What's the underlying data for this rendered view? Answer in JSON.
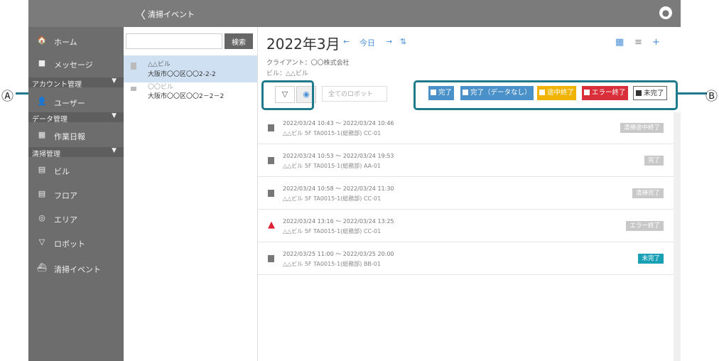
{
  "topbar": {
    "back": "〈",
    "title": "清掃イベント"
  },
  "sidebar": {
    "items": [
      {
        "icon": "🏠",
        "label": "ホーム"
      },
      {
        "icon": "■",
        "label": "メッセージ"
      }
    ],
    "sec1": "アカウント管理",
    "user": {
      "icon": "👤",
      "label": "ユーザー"
    },
    "sec2": "データ管理",
    "work": {
      "icon": "▦",
      "label": "作業日報"
    },
    "sec3": "清掃管理",
    "items2": [
      {
        "icon": "▤",
        "label": "ビル"
      },
      {
        "icon": "▤",
        "label": "フロア"
      },
      {
        "icon": "◎",
        "label": "エリア"
      },
      {
        "icon": "▽",
        "label": "ロボット"
      },
      {
        "icon": "⛴",
        "label": "清掃イベント"
      }
    ]
  },
  "list": {
    "search_btn": "検索",
    "buildings": [
      {
        "name": "△△ビル",
        "addr": "大阪市〇〇区〇〇2-2-2"
      },
      {
        "name": "〇〇ビル",
        "addr": "大阪市〇〇区〇〇2－2－2"
      }
    ]
  },
  "main": {
    "month": "2022年3月",
    "prev": "←",
    "today": "今日",
    "next": "→",
    "sort": "⇅",
    "client": "クライアント：〇〇株式会社",
    "building": "ビル：△△ビル",
    "robot_select": "全てのロボット",
    "chips": [
      {
        "label": "完了",
        "color": "#4a90c9"
      },
      {
        "label": "完了（データなし）",
        "color": "#4a90c9"
      },
      {
        "label": "途中終了",
        "color": "#f0b400"
      },
      {
        "label": "エラー終了",
        "color": "#d92f3a"
      },
      {
        "label": "未完了",
        "color": "#ffffff"
      }
    ],
    "events": [
      {
        "time": "2022/03/24 10:43 ～ 2022/03/24 10:46",
        "loc": "△△ビル 5F TA0015-1(総務部) CC-01",
        "status": "清掃途中終了",
        "color": "#c8c8c8",
        "warn": false
      },
      {
        "time": "2022/03/24 10:53 ～ 2022/03/24 19:53",
        "loc": "△△ビル 5F TA0015-1(総務部) AA-01",
        "status": "完了",
        "color": "#c8c8c8",
        "warn": false
      },
      {
        "time": "2022/03/24 10:58 ～ 2022/03/24 11:30",
        "loc": "△△ビル 5F TA0015-1(総務部) CC-01",
        "status": "清掃完了",
        "color": "#c8c8c8",
        "warn": false
      },
      {
        "time": "2022/03/24 13:16 ～ 2022/03/24 13:25",
        "loc": "△△ビル 5F TA0015-1(総務部) CC-01",
        "status": "エラー終了",
        "color": "#c8c8c8",
        "warn": true
      },
      {
        "time": "2022/03/25 11:00 ～ 2022/03/25 20:00",
        "loc": "△△ビル 5F TA0015-1(総務部) BB-01",
        "status": "未完了",
        "color": "#1aa0b5",
        "warn": false
      }
    ]
  },
  "labels": {
    "a": "Ⓐ",
    "b": "Ⓑ"
  }
}
